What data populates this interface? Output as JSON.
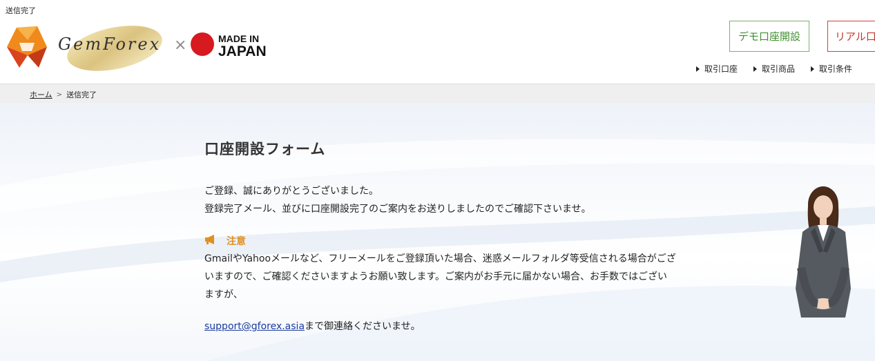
{
  "top_note": "送信完了",
  "logo": {
    "brand": "GemForex",
    "times": "×",
    "made": "MADE IN",
    "japan": "JAPAN"
  },
  "header": {
    "demo_button": "デモ口座開設",
    "real_button": "リアル口",
    "subnav": [
      "取引口座",
      "取引商品",
      "取引条件"
    ]
  },
  "breadcrumb": {
    "home": "ホーム",
    "separator": ">",
    "current": "送信完了"
  },
  "main": {
    "title": "口座開設フォーム",
    "thanks_line1": "ご登録、誠にありがとうございました。",
    "thanks_line2": "登録完了メール、並びに口座開設完了のご案内をお送りしましたのでご確認下さいませ。",
    "notice_label": "注意",
    "notice_line1": "GmailやYahooメールなど、フリーメールをご登録頂いた場合、迷惑メールフォルダ等受信される場合がござ",
    "notice_line2": "いますので、ご確認くださいますようお願い致します。ご案内がお手元に届かない場合、お手数ではござい",
    "notice_line3": "ますが、",
    "contact_email": "support@gforex.asia",
    "contact_suffix": "まで御連絡くださいませ。"
  },
  "colors": {
    "demo_green": "#3f8f2e",
    "real_red": "#c0392b",
    "notice_orange": "#e09020",
    "link_blue": "#1a3a9e"
  },
  "icons": [
    "gemforex-logo-icon",
    "japan-flag-icon",
    "megaphone-icon"
  ]
}
